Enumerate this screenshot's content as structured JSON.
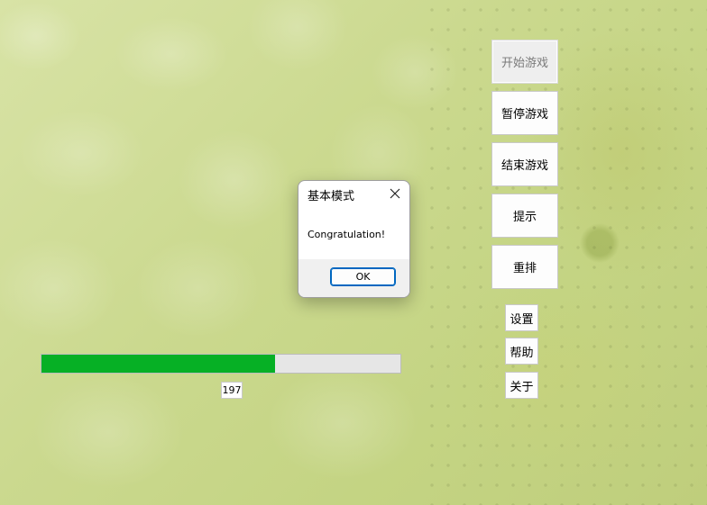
{
  "buttons": {
    "start": "开始游戏",
    "pause": "暂停游戏",
    "end": "结束游戏",
    "hint": "提示",
    "shuffle": "重排",
    "settings": "设置",
    "help": "帮助",
    "about": "关于"
  },
  "progress": {
    "fraction": 0.65,
    "fill_color": "#06b025",
    "score": "197"
  },
  "dialog": {
    "title": "基本模式",
    "message": "Congratulation!",
    "ok_label": "OK",
    "close_icon": "close-icon"
  }
}
